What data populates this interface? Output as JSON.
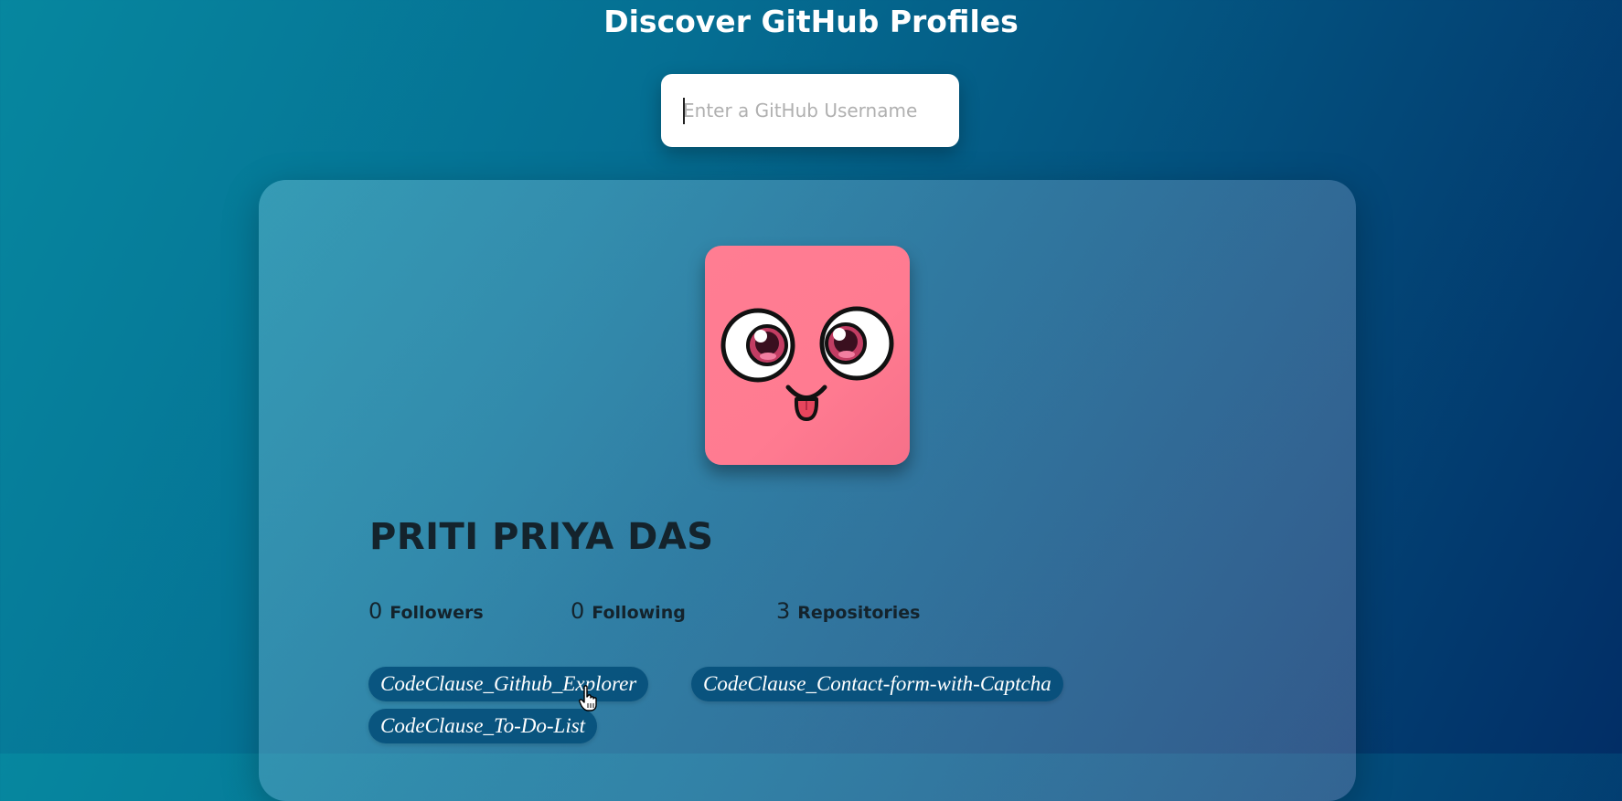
{
  "header": {
    "title": "Discover GitHub Profiles"
  },
  "search": {
    "placeholder": "Enter a GitHub Username",
    "value": ""
  },
  "profile": {
    "name": "PRITI PRIYA DAS",
    "avatar_icon": "cute-face-avatar",
    "avatar_color": "#ff7b91",
    "stats": [
      {
        "count": "0",
        "label": "Followers"
      },
      {
        "count": "0",
        "label": "Following"
      },
      {
        "count": "3",
        "label": "Repositories"
      }
    ],
    "repos": [
      "CodeClause_Github_Explorer",
      "CodeClause_Contact-form-with-Captcha",
      "CodeClause_To-Do-List"
    ]
  },
  "colors": {
    "background_start": "#06879f",
    "background_end": "#022e66",
    "chip_background": "#024c78",
    "text_dark": "#14232c"
  },
  "cursor_icon": "hand-pointer-icon"
}
